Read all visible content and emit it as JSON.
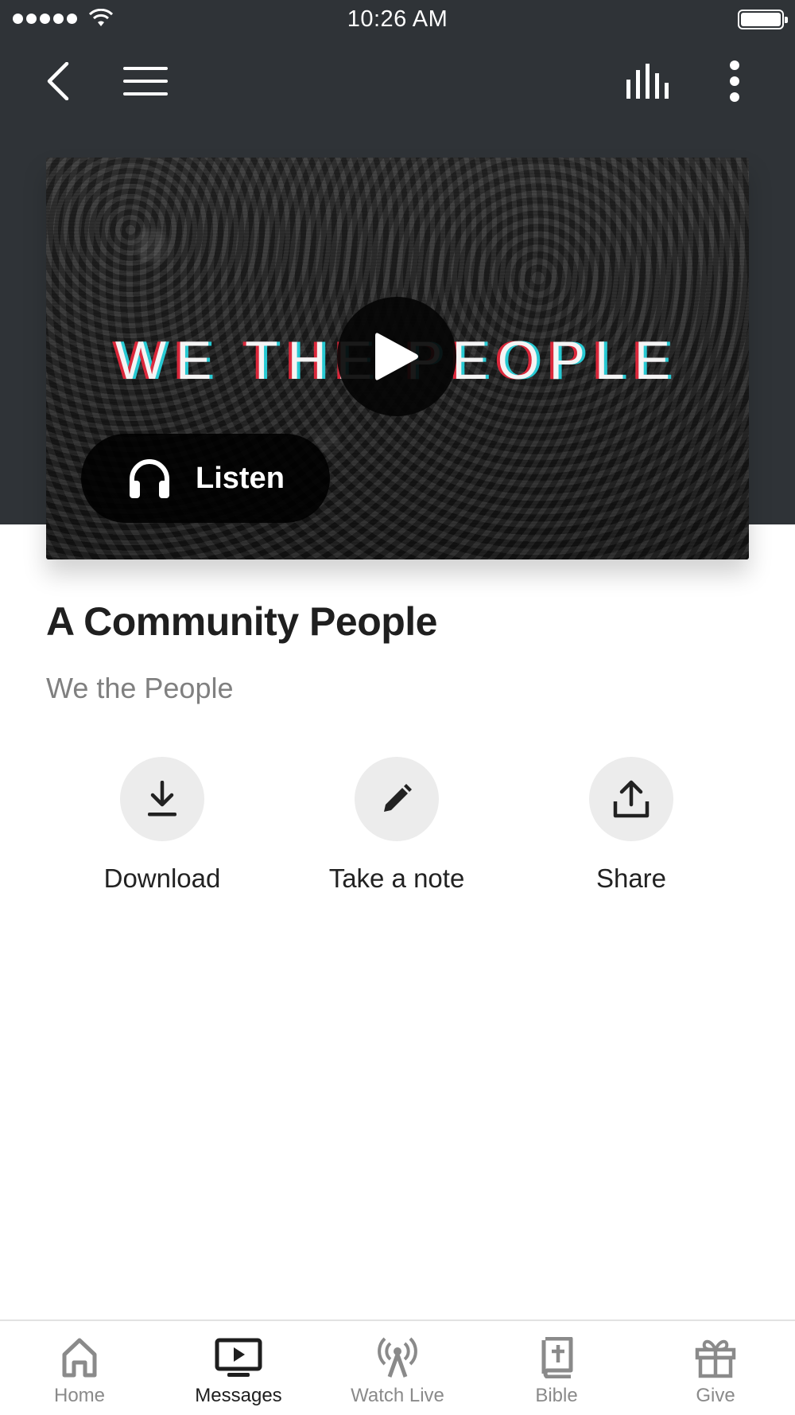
{
  "status_bar": {
    "time": "10:26 AM"
  },
  "toolbar": {
    "icons": [
      "back-chevron-icon",
      "hamburger-menu-icon",
      "audio-levels-icon",
      "more-vertical-icon"
    ]
  },
  "hero": {
    "artwork_title": "WE THE PEOPLE",
    "listen_label": "Listen"
  },
  "message": {
    "title": "A Community People",
    "series": "We the People"
  },
  "actions": [
    {
      "label": "Download",
      "icon": "download-icon"
    },
    {
      "label": "Take a note",
      "icon": "pencil-icon"
    },
    {
      "label": "Share",
      "icon": "share-icon"
    }
  ],
  "tabs": [
    {
      "label": "Home",
      "icon": "home-icon",
      "active": false
    },
    {
      "label": "Messages",
      "icon": "messages-tv-icon",
      "active": true
    },
    {
      "label": "Watch Live",
      "icon": "broadcast-antenna-icon",
      "active": false
    },
    {
      "label": "Bible",
      "icon": "bible-icon",
      "active": false
    },
    {
      "label": "Give",
      "icon": "gift-icon",
      "active": false
    }
  ],
  "colors": {
    "header_background": "#2f3337",
    "action_circle": "#ececec",
    "tab_inactive": "#8a8a8a",
    "tab_active": "#1e1e1e"
  }
}
